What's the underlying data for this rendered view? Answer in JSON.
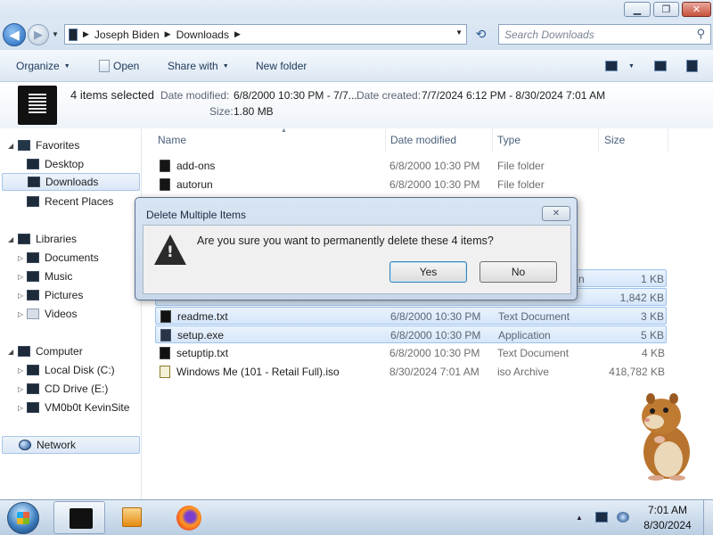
{
  "address": {
    "crumbs": [
      "Joseph Biden",
      "Downloads"
    ],
    "search_placeholder": "Search Downloads"
  },
  "toolbar": {
    "organize": "Organize",
    "open": "Open",
    "share_with": "Share with",
    "new_folder": "New folder"
  },
  "details": {
    "selection": "4 items selected",
    "date_modified_label": "Date modified:",
    "date_modified_value": "6/8/2000 10:30 PM - 7/7...",
    "date_created_label": "Date created:",
    "date_created_value": "7/7/2024 6:12 PM - 8/30/2024 7:01 AM",
    "size_label": "Size:",
    "size_value": "1.80 MB"
  },
  "nav": {
    "favorites": "Favorites",
    "desktop": "Desktop",
    "downloads": "Downloads",
    "recent_places": "Recent Places",
    "libraries": "Libraries",
    "documents": "Documents",
    "music": "Music",
    "pictures": "Pictures",
    "videos": "Videos",
    "computer": "Computer",
    "local_disk": "Local Disk (C:)",
    "cd_drive": "CD Drive (E:)",
    "network_share": "VM0b0t KevinSite",
    "network": "Network"
  },
  "columns": {
    "name": "Name",
    "date_modified": "Date modified",
    "type": "Type",
    "size": "Size"
  },
  "files": [
    {
      "name": "add-ons",
      "date": "6/8/2000 10:30 PM",
      "type": "File folder",
      "size": ""
    },
    {
      "name": "autorun",
      "date": "6/8/2000 10:30 PM",
      "type": "File folder",
      "size": ""
    },
    {
      "name": "",
      "date": "",
      "type": "n",
      "size": "1 KB"
    },
    {
      "name": "",
      "date": "",
      "type": "",
      "size": "1,842 KB"
    },
    {
      "name": "readme.txt",
      "date": "6/8/2000 10:30 PM",
      "type": "Text Document",
      "size": "3 KB"
    },
    {
      "name": "setup.exe",
      "date": "6/8/2000 10:30 PM",
      "type": "Application",
      "size": "5 KB"
    },
    {
      "name": "setuptip.txt",
      "date": "6/8/2000 10:30 PM",
      "type": "Text Document",
      "size": "4 KB"
    },
    {
      "name": "Windows Me (101 - Retail Full).iso",
      "date": "8/30/2024 7:01 AM",
      "type": "iso Archive",
      "size": "418,782 KB"
    }
  ],
  "dialog": {
    "title": "Delete Multiple Items",
    "message": "Are you sure you want to permanently delete these 4 items?",
    "yes": "Yes",
    "no": "No"
  },
  "clock": {
    "time": "7:01 AM",
    "date": "8/30/2024"
  }
}
